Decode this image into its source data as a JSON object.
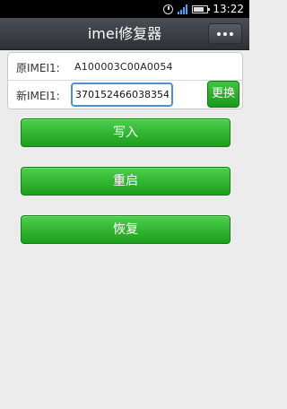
{
  "status_bar": {
    "time": "13:22",
    "battery_icon": "battery-icon",
    "signal_icon": "signal-icon",
    "alarm_icon": "alarm-icon"
  },
  "header": {
    "title": "imei修复器",
    "menu_icon": "overflow-menu-icon"
  },
  "imei": {
    "original_label": "原IMEI1:",
    "original_value": "A100003C00A0054",
    "new_label": "新IMEI1:",
    "new_value": "370152466038354",
    "replace_label": "更换"
  },
  "actions": {
    "write_label": "写入",
    "restart_label": "重启",
    "restore_label": "恢复"
  },
  "colors": {
    "accent_green": "#22a822",
    "header_dark": "#3a3e44",
    "input_border": "#4d8fd6"
  }
}
